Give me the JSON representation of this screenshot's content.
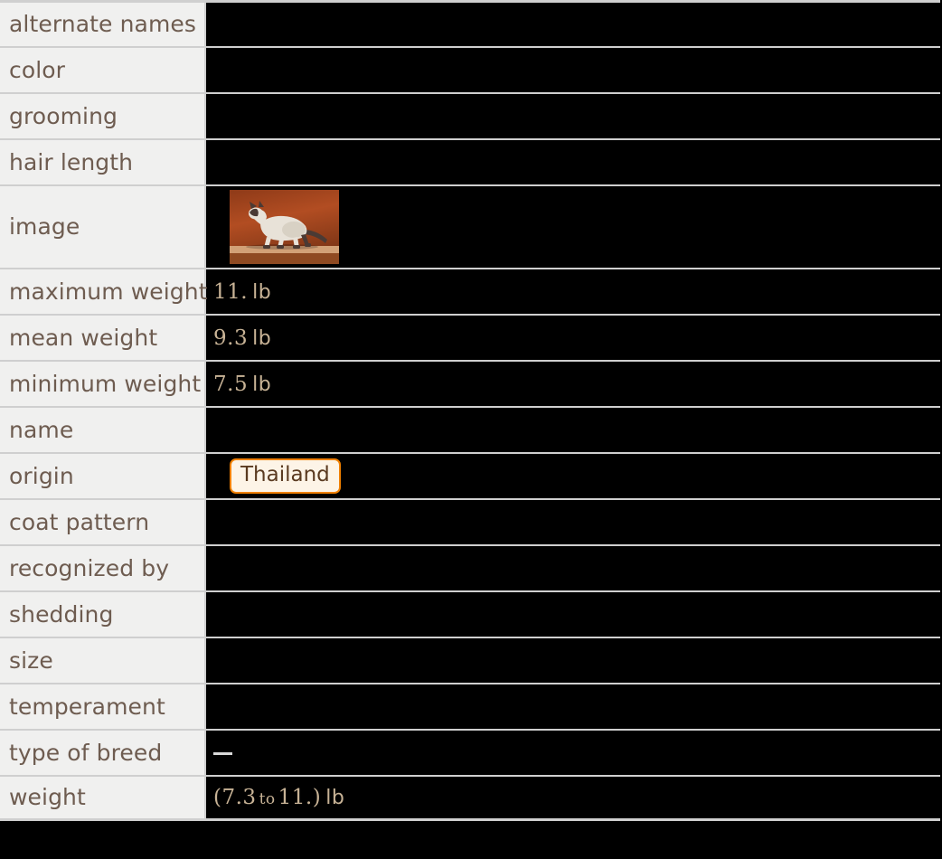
{
  "table": {
    "rows": [
      {
        "label": "alternate names",
        "kind": "empty",
        "value": ""
      },
      {
        "label": "color",
        "kind": "empty",
        "value": ""
      },
      {
        "label": "grooming",
        "kind": "empty",
        "value": ""
      },
      {
        "label": "hair length",
        "kind": "empty",
        "value": ""
      },
      {
        "label": "image",
        "kind": "image",
        "value": "siamese-cat-photo"
      },
      {
        "label": "maximum weight",
        "kind": "qty",
        "number": "11.",
        "unit": "lb",
        "value": "11. lb"
      },
      {
        "label": "mean weight",
        "kind": "qty",
        "number": "9.3",
        "unit": "lb",
        "value": "9.3 lb"
      },
      {
        "label": "minimum weight",
        "kind": "qty",
        "number": "7.5",
        "unit": "lb",
        "value": "7.5 lb"
      },
      {
        "label": "name",
        "kind": "empty",
        "value": ""
      },
      {
        "label": "origin",
        "kind": "pill",
        "value": "Thailand"
      },
      {
        "label": "coat pattern",
        "kind": "empty",
        "value": ""
      },
      {
        "label": "recognized by",
        "kind": "empty",
        "value": ""
      },
      {
        "label": "shedding",
        "kind": "empty",
        "value": ""
      },
      {
        "label": "size",
        "kind": "empty",
        "value": ""
      },
      {
        "label": "temperament",
        "kind": "empty",
        "value": ""
      },
      {
        "label": "type of breed",
        "kind": "dash",
        "value": "—"
      },
      {
        "label": "weight",
        "kind": "range",
        "open": "(",
        "low": "7.3",
        "to": "to",
        "high": "11.",
        "close": ")",
        "unit": "lb",
        "value": "(7.3 to 11.) lb"
      }
    ]
  },
  "image_cell": {
    "alt": "Siamese cat walking on a wooden ledge against a rust-orange backdrop",
    "background_color": "#a8441e",
    "ledge_color": "#d2a177",
    "cat_body_color": "#e8e2d8",
    "cat_point_color": "#4a3a34"
  },
  "colors": {
    "label_background": "#f0f0ef",
    "label_text": "#6e5c50",
    "value_background": "#000000",
    "value_text": "#c8b396",
    "grid_line": "#cfcfcf",
    "pill_background": "#fdf4e7",
    "pill_border": "#f08000",
    "pill_text": "#5a3a20",
    "dash_color": "#d8d8d8",
    "page_background": "#000000"
  }
}
